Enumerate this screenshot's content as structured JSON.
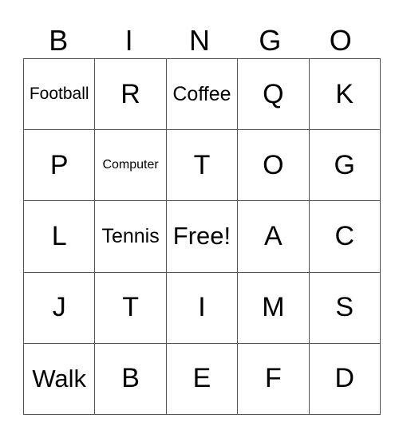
{
  "header": [
    "B",
    "I",
    "N",
    "G",
    "O"
  ],
  "rows": [
    [
      {
        "text": "Football",
        "size": "s"
      },
      {
        "text": "R",
        "size": "xl"
      },
      {
        "text": "Coffee",
        "size": "m"
      },
      {
        "text": "Q",
        "size": "xl"
      },
      {
        "text": "K",
        "size": "xl"
      }
    ],
    [
      {
        "text": "P",
        "size": "xl"
      },
      {
        "text": "Computer",
        "size": "xs"
      },
      {
        "text": "T",
        "size": "xl"
      },
      {
        "text": "O",
        "size": "xl"
      },
      {
        "text": "G",
        "size": "xl"
      }
    ],
    [
      {
        "text": "L",
        "size": "xl"
      },
      {
        "text": "Tennis",
        "size": "m"
      },
      {
        "text": "Free!",
        "size": "l"
      },
      {
        "text": "A",
        "size": "xl"
      },
      {
        "text": "C",
        "size": "xl"
      }
    ],
    [
      {
        "text": "J",
        "size": "xl"
      },
      {
        "text": "T",
        "size": "xl"
      },
      {
        "text": "I",
        "size": "xl"
      },
      {
        "text": "M",
        "size": "xl"
      },
      {
        "text": "S",
        "size": "xl"
      }
    ],
    [
      {
        "text": "Walk",
        "size": "l"
      },
      {
        "text": "B",
        "size": "xl"
      },
      {
        "text": "E",
        "size": "xl"
      },
      {
        "text": "F",
        "size": "xl"
      },
      {
        "text": "D",
        "size": "xl"
      }
    ]
  ]
}
